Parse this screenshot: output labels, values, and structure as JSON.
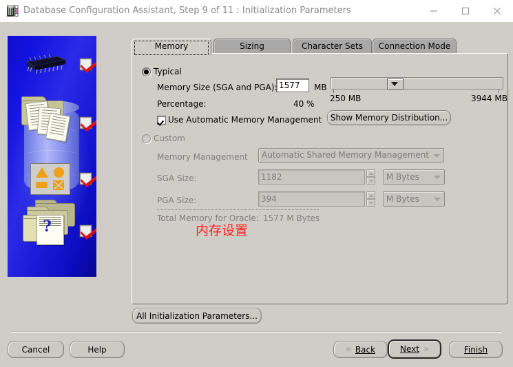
{
  "window": {
    "title": "Database Configuration Assistant, Step 9 of 11 : Initialization Parameters",
    "app_icon": "database-chip-icon",
    "minimize_label": "Minimize",
    "maximize_label": "Maximize",
    "close_label": "Close"
  },
  "tabs": [
    {
      "label": "Memory",
      "active": true
    },
    {
      "label": "Sizing",
      "active": false
    },
    {
      "label": "Character Sets",
      "active": false
    },
    {
      "label": "Connection Mode",
      "active": false
    }
  ],
  "memory_tab": {
    "typical": {
      "radio_label": "Typical",
      "selected": true,
      "memory_size_label": "Memory Size (SGA and PGA):",
      "memory_size_value": "1577",
      "memory_size_unit": "MB",
      "percentage_label": "Percentage:",
      "percentage_value": "40 %",
      "slider_min_label": "250 MB",
      "slider_max_label": "3944 MB",
      "slider_min": 250,
      "slider_max": 3944,
      "slider_value": 1577,
      "auto_memory_label": "Use Automatic Memory Management",
      "auto_memory_checked": true,
      "show_distribution_label": "Show Memory Distribution..."
    },
    "custom": {
      "radio_label": "Custom",
      "selected": false,
      "memory_management_label": "Memory Management",
      "memory_management_value": "Automatic Shared Memory Management",
      "sga_label": "SGA Size:",
      "sga_value": "1182",
      "sga_unit": "M Bytes",
      "pga_label": "PGA Size:",
      "pga_value": "394",
      "pga_unit": "M Bytes",
      "total_label": "Total Memory for Oracle:",
      "total_value": "1577 M Bytes"
    },
    "annotation": "内存设置"
  },
  "footer": {
    "all_params_label": "All Initialization Parameters...",
    "cancel_label": "Cancel",
    "help_label": "Help",
    "back_label": "Back",
    "back_chevron": "«",
    "next_label": "Next",
    "next_chevron": "»",
    "finish_label": "Finish"
  },
  "banner": {
    "alt": "oracle-database-configuration-illustration"
  },
  "colors": {
    "face": "#d0cdc8",
    "annotation_red": "#ff2020",
    "banner_blue": "#1414e0",
    "checkmark_red": "#e01010"
  }
}
